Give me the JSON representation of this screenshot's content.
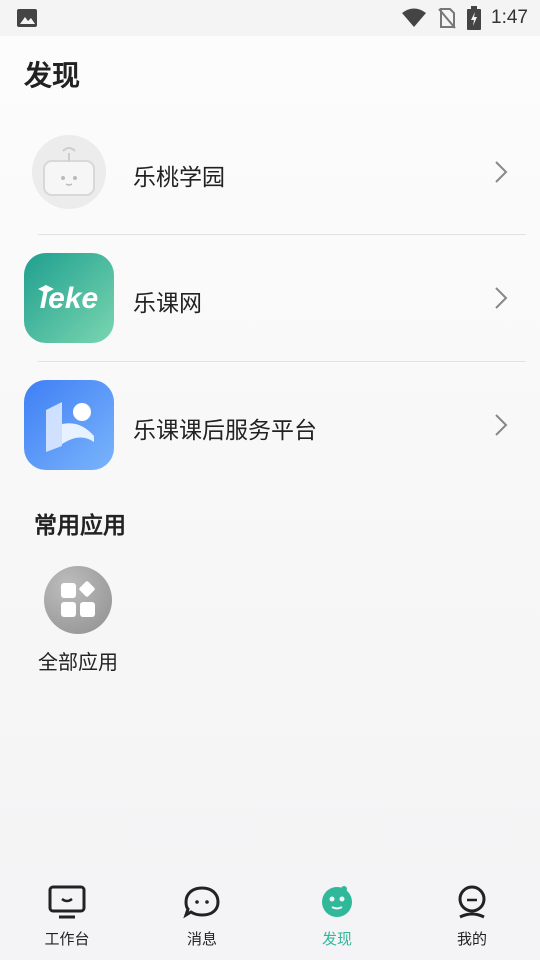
{
  "status_bar": {
    "time": "1:47"
  },
  "page": {
    "title": "发现"
  },
  "links": [
    {
      "label": "乐桃学园",
      "icon": "mascot-tv-icon"
    },
    {
      "label": "乐课网",
      "icon": "leke-logo-icon",
      "logo_text": "leke"
    },
    {
      "label": "乐课课后服务平台",
      "icon": "book-person-icon"
    }
  ],
  "common_apps": {
    "title": "常用应用",
    "items": [
      {
        "label": "全部应用",
        "icon": "grid-apps-icon"
      }
    ]
  },
  "tabs": [
    {
      "label": "工作台",
      "icon": "monitor-icon",
      "active": false
    },
    {
      "label": "消息",
      "icon": "chat-bubble-icon",
      "active": false
    },
    {
      "label": "发现",
      "icon": "discover-planet-icon",
      "active": true
    },
    {
      "label": "我的",
      "icon": "profile-icon",
      "active": false
    }
  ],
  "colors": {
    "accent": "#2fb89a",
    "leke_teal": "#22a896",
    "platform_blue": "#4a8df8"
  }
}
